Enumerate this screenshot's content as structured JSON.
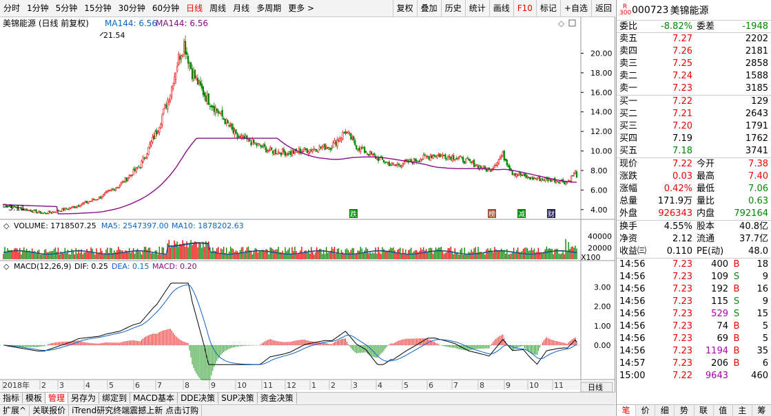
{
  "toolbar": {
    "periods": [
      "分时",
      "1分钟",
      "5分钟",
      "15分钟",
      "30分钟",
      "60分钟",
      "日线",
      "周线",
      "月线",
      "多周期",
      "更多 >"
    ],
    "active": "日线",
    "right": [
      "复权",
      "叠加",
      "历史",
      "统计",
      "画线",
      "F10",
      "标记",
      "+自选",
      "返回"
    ]
  },
  "chart": {
    "title": "美锦能源 (日线 前复权)",
    "ma_text1": "MA144: 6.56",
    "ma_text2": "MA144: 6.56",
    "high_label": "21.54",
    "low_label": "3.11",
    "yticks": [
      "20.00",
      "18.00",
      "16.00",
      "14.00",
      "12.00",
      "10.00",
      "8.00",
      "6.00",
      "4.00"
    ],
    "yvals": [
      20,
      18,
      16,
      14,
      12,
      10,
      8,
      6,
      4
    ],
    "marks": [
      "跌",
      "榜",
      "减",
      "财"
    ],
    "volume": {
      "label": "VOLUME: 1718507.25",
      "ma5": "MA5: 2547397.00",
      "ma10": "MA10: 1878202.63",
      "ticks": [
        "40000",
        "20000"
      ],
      "unit": "X100"
    },
    "macd": {
      "label": "MACD(12,26,9)",
      "dif": "DIF: 0.25",
      "dea": "DEA: 0.15",
      "macd": "MACD: 0.20",
      "ticks": [
        "3.00",
        "2.00",
        "1.00",
        "0.00"
      ]
    },
    "xaxis": [
      "2018年",
      "2",
      "3",
      "4",
      "5",
      "6",
      "7",
      "8",
      "9",
      "10",
      "11",
      "12",
      "1",
      "2",
      "3",
      "4",
      "5",
      "6",
      "7",
      "8",
      "9",
      "10",
      "11"
    ],
    "period_btn": "日线",
    "plus": "+",
    "minus": "−"
  },
  "tabs": [
    "指标",
    "模板",
    "管理",
    "另存为",
    "绑定到",
    "MACD基本",
    "DDE决策",
    "SUP决策",
    "资金决策"
  ],
  "active_tab": "管理",
  "status": [
    "扩展^",
    "关联报价",
    "iTrend研究终端震撼上新 点击订购"
  ],
  "quote": {
    "badge_top": "R",
    "badge_bot": "300",
    "code": "000723",
    "name": "美锦能源",
    "weibi_label": "委比",
    "weibi": "-8.82%",
    "weicha_label": "委差",
    "weicha": "-1948",
    "sell": [
      {
        "l": "卖五",
        "p": "7.27",
        "v": "2202"
      },
      {
        "l": "卖四",
        "p": "7.26",
        "v": "2181"
      },
      {
        "l": "卖三",
        "p": "7.25",
        "v": "2858"
      },
      {
        "l": "卖二",
        "p": "7.24",
        "v": "1588"
      },
      {
        "l": "卖一",
        "p": "7.23",
        "v": "3185"
      }
    ],
    "buy": [
      {
        "l": "买一",
        "p": "7.22",
        "v": "129"
      },
      {
        "l": "买二",
        "p": "7.21",
        "v": "2643"
      },
      {
        "l": "买三",
        "p": "7.20",
        "v": "1791"
      },
      {
        "l": "买四",
        "p": "7.19",
        "v": "1762"
      },
      {
        "l": "买五",
        "p": "7.18",
        "v": "3741"
      }
    ],
    "stats": [
      {
        "l1": "现价",
        "v1": "7.22",
        "c1": "red",
        "l2": "今开",
        "v2": "7.38",
        "c2": "red"
      },
      {
        "l1": "涨跌",
        "v1": "0.03",
        "c1": "red",
        "l2": "最高",
        "v2": "7.40",
        "c2": "red"
      },
      {
        "l1": "涨幅",
        "v1": "0.42%",
        "c1": "red",
        "l2": "最低",
        "v2": "7.06",
        "c2": "grn"
      },
      {
        "l1": "总量",
        "v1": "171.9万",
        "c1": "",
        "l2": "量比",
        "v2": "0.63",
        "c2": "grn"
      },
      {
        "l1": "外盘",
        "v1": "926343",
        "c1": "red",
        "l2": "内盘",
        "v2": "792164",
        "c2": "grn"
      }
    ],
    "stats2": [
      {
        "l1": "换手",
        "v1": "4.55%",
        "l2": "股本",
        "v2": "40.8亿"
      },
      {
        "l1": "净资",
        "v1": "2.12",
        "l2": "流通",
        "v2": "37.7亿"
      },
      {
        "l1": "收益㈢",
        "v1": "0.110",
        "l2": "PE(动)",
        "v2": "48.0"
      }
    ],
    "ticks": [
      {
        "t": "14:56",
        "p": "7.23",
        "v": "400",
        "s": "B",
        "n": "18",
        "vc": ""
      },
      {
        "t": "14:56",
        "p": "7.23",
        "v": "109",
        "s": "S",
        "n": "9",
        "vc": ""
      },
      {
        "t": "14:56",
        "p": "7.23",
        "v": "192",
        "s": "B",
        "n": "16",
        "vc": ""
      },
      {
        "t": "14:56",
        "p": "7.23",
        "v": "115",
        "s": "S",
        "n": "9",
        "vc": ""
      },
      {
        "t": "14:56",
        "p": "7.23",
        "v": "529",
        "s": "S",
        "n": "15",
        "vc": "pur"
      },
      {
        "t": "14:56",
        "p": "7.23",
        "v": "74",
        "s": "B",
        "n": "5",
        "vc": ""
      },
      {
        "t": "14:56",
        "p": "7.23",
        "v": "69",
        "s": "B",
        "n": "5",
        "vc": ""
      },
      {
        "t": "14:56",
        "p": "7.23",
        "v": "1194",
        "s": "B",
        "n": "35",
        "vc": "pur"
      },
      {
        "t": "14:57",
        "p": "7.23",
        "v": "206",
        "s": "B",
        "n": "6",
        "vc": ""
      },
      {
        "t": "15:00",
        "p": "7.22",
        "v": "9643",
        "s": "",
        "n": "460",
        "vc": "pur"
      }
    ],
    "bottom_tabs": [
      "笔",
      "价",
      "细",
      "势",
      "联",
      "值",
      "主",
      "筹"
    ],
    "active_bottom": "笔"
  }
}
